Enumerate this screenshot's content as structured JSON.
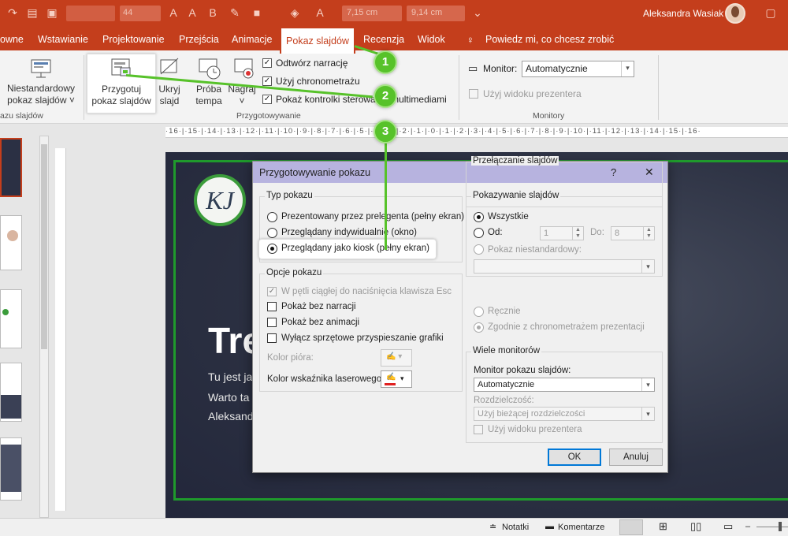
{
  "titlebar": {
    "font_size": "44",
    "width_field": "7,15 cm",
    "height_field": "9,14 cm",
    "user_name": "Aleksandra Wasiak"
  },
  "tabs": [
    "owne",
    "Wstawianie",
    "Projektowanie",
    "Przejścia",
    "Animacje",
    "Pokaz slajdów",
    "Recenzja",
    "Widok"
  ],
  "tell_me": "Powiedz mi, co chcesz zrobić",
  "ribbon": {
    "custom_show": "Niestandardowy pokaz slajdów",
    "custom_show_l1": "Niestandardowy",
    "custom_show_l2": "pokaz slajdów ˅",
    "setup_l1": "Przygotuj",
    "setup_l2": "pokaz slajdów",
    "hide_l1": "Ukryj",
    "hide_l2": "slajd",
    "rehearse_l1": "Próba",
    "rehearse_l2": "tempa",
    "record_l1": "Nagraj",
    "record_l2": "˅",
    "play_narration": "Odtwórz narrację",
    "use_timings": "Użyj chronometrażu",
    "show_media_controls": "Pokaż kontrolki sterowania multimediami",
    "group_start": "azu slajdów",
    "group_setup": "Przygotowywanie",
    "group_monitors": "Monitory",
    "monitor_label": "Monitor:",
    "monitor_value": "Automatycznie",
    "presenter_view": "Użyj widoku prezentera"
  },
  "ruler_text": "·16·|·15·|·14·|·13·|·12·|·11·|·10·|·9·|·8·|·7·|·6·|·5·|·4·|·3·|·2·|·1·|·0·|·1·|·2·|·3·|·4·|·5·|·6·|·7·|·8·|·9·|·10·|·11·|·12·|·13·|·14·|·15·|·16·",
  "slide": {
    "logo": "KJ",
    "title": "Tre",
    "line1": "Tu jest jak",
    "line2": "Warto ta",
    "line3": "Aleksand"
  },
  "dialog": {
    "title": "Przygotowywanie pokazu",
    "help": "?",
    "close": "✕",
    "show_type": {
      "label": "Typ pokazu",
      "options": [
        "Prezentowany przez prelegenta (pełny ekran)",
        "Przeglądany indywidualnie (okno)",
        "Przeglądany jako kiosk (pełny ekran)"
      ],
      "selected": 2
    },
    "show_options": {
      "label": "Opcje pokazu",
      "loop": "W pętli ciągłej do naciśnięcia klawisza Esc",
      "no_narration": "Pokaż bez narracji",
      "no_animation": "Pokaż bez animacji",
      "disable_hw": "Wyłącz sprzętowe przyspieszanie grafiki",
      "pen_color": "Kolor pióra:",
      "laser_color": "Kolor wskaźnika laserowego:"
    },
    "show_slides": {
      "label": "Pokazywanie slajdów",
      "all": "Wszystkie",
      "from": "Od:",
      "from_value": "1",
      "to": "Do:",
      "to_value": "8",
      "custom": "Pokaz niestandardowy:"
    },
    "advance": {
      "label": "Przełączanie slajdów",
      "manual": "Ręcznie",
      "timings": "Zgodnie z chronometrażem prezentacji"
    },
    "monitors": {
      "label": "Wiele monitorów",
      "slideshow_monitor": "Monitor pokazu slajdów:",
      "monitor_value": "Automatycznie",
      "resolution": "Rozdzielczość:",
      "resolution_value": "Użyj bieżącej rozdzielczości",
      "presenter_view": "Użyj widoku prezentera"
    },
    "ok": "OK",
    "cancel": "Anuluj"
  },
  "callouts": [
    "1",
    "2",
    "3"
  ],
  "status": {
    "notes": "Notatki",
    "comments": "Komentarze"
  },
  "colors": {
    "accent": "#c43e1c",
    "callout": "#57c22a",
    "laser": "#e02020"
  }
}
